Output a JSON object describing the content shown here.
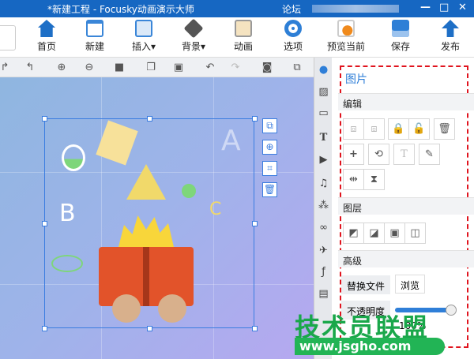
{
  "window": {
    "title": "*新建工程 - Focusky动画演示大师",
    "forum": "论坛",
    "controls": [
      "—",
      "□",
      "✕"
    ]
  },
  "toolbar": [
    {
      "label": "首页",
      "icon": "home-icon",
      "color": "#1e6fc6"
    },
    {
      "label": "新建",
      "icon": "new-icon",
      "color": "#3a86d8"
    },
    {
      "label": "插入▾",
      "icon": "insert-icon",
      "color": "#3a86d8"
    },
    {
      "label": "背景▾",
      "icon": "background-icon",
      "color": "#555"
    },
    {
      "label": "动画",
      "icon": "animation-icon",
      "color": "#f0a030"
    },
    {
      "label": "选项",
      "icon": "options-gear-icon",
      "color": "#2e7fd6"
    },
    {
      "label": "预览当前",
      "icon": "preview-icon",
      "color": "#f08a1c"
    },
    {
      "label": "保存",
      "icon": "save-icon",
      "color": "#2e7fd6"
    },
    {
      "label": "发布",
      "icon": "publish-icon",
      "color": "#1e6fc6"
    }
  ],
  "panel": {
    "title": "图片",
    "edit": "编辑",
    "layer": "图层",
    "advanced": "高级",
    "replace": "替换文件",
    "browse": "浏览",
    "opacity_label": "不透明度",
    "opacity": "100%",
    "opacity_value": 1.0
  },
  "watermark": {
    "text": "技术员联盟",
    "url": "www.jsgho.com"
  },
  "colors": {
    "accent": "#1667c2",
    "selection": "#3b7de0",
    "dash": "#e0141e"
  }
}
